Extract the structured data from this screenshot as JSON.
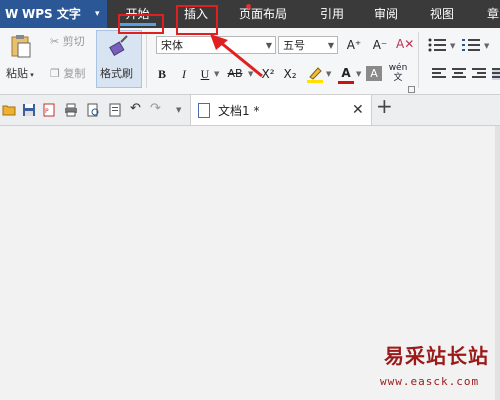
{
  "app": {
    "logo_letter": "W",
    "title": "WPS 文字",
    "menu_arrow": "▾"
  },
  "menu_tabs": [
    "开始",
    "插入",
    "页面布局",
    "引用",
    "审阅",
    "视图",
    "章"
  ],
  "ribbon": {
    "paste": "粘贴",
    "cut": "剪切",
    "copy": "复制",
    "format_painter": "格式刷",
    "font_name": "宋体",
    "font_size": "五号",
    "bold": "B",
    "italic": "I",
    "underline": "U",
    "strikethrough": "AB",
    "superscript": "X²",
    "subscript": "X₂",
    "font_color": "A",
    "shading": "A",
    "pinyin": "wén 文",
    "grow_font": "A⁺",
    "shrink_font": "A⁻"
  },
  "document_tab": {
    "title": "文档1 *",
    "close": "✕",
    "new_tab": "+"
  },
  "watermark": {
    "name": "易采站长站",
    "url": "www.easck.com"
  },
  "colors": {
    "accent": "#2b5797",
    "annotation": "#e02020",
    "menubar": "#3a3a3a"
  }
}
